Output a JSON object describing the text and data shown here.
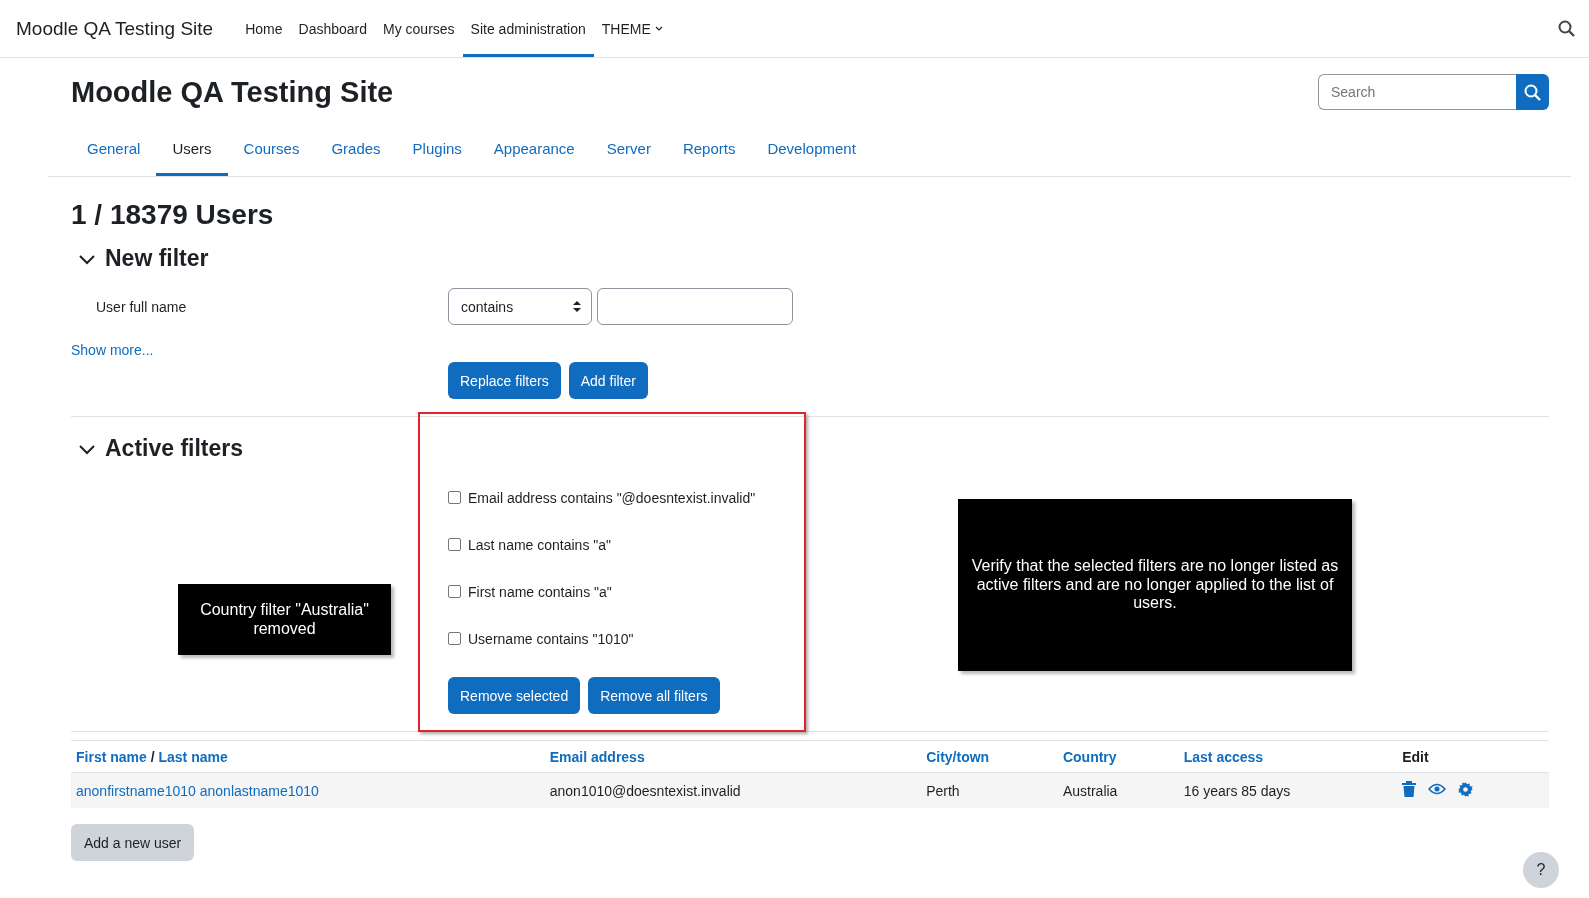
{
  "navbar": {
    "brand": "Moodle QA Testing Site",
    "items": [
      {
        "label": "Home",
        "selected": false,
        "kind": "link"
      },
      {
        "label": "Dashboard",
        "selected": false,
        "kind": "link"
      },
      {
        "label": "My courses",
        "selected": false,
        "kind": "link"
      },
      {
        "label": "Site administration",
        "selected": true,
        "kind": "link"
      },
      {
        "label": "THEME",
        "selected": false,
        "kind": "dropdown"
      }
    ]
  },
  "header": {
    "title": "Moodle QA Testing Site",
    "search": {
      "placeholder": "Search"
    }
  },
  "tabs": [
    {
      "label": "General",
      "selected": false
    },
    {
      "label": "Users",
      "selected": true
    },
    {
      "label": "Courses",
      "selected": false
    },
    {
      "label": "Grades",
      "selected": false
    },
    {
      "label": "Plugins",
      "selected": false
    },
    {
      "label": "Appearance",
      "selected": false
    },
    {
      "label": "Server",
      "selected": false
    },
    {
      "label": "Reports",
      "selected": false
    },
    {
      "label": "Development",
      "selected": false
    }
  ],
  "page_heading": "1 / 18379 Users",
  "new_filter": {
    "title": "New filter",
    "expanded": true,
    "field_label": "User full name",
    "operator": "contains",
    "show_more": "Show more...",
    "buttons": [
      "Replace filters",
      "Add filter"
    ]
  },
  "active_filters": {
    "title": "Active filters",
    "expanded": true,
    "filters": [
      {
        "label": "Email address contains \"@doesntexist.invalid\"",
        "checked": false
      },
      {
        "label": "Last name contains \"a\"",
        "checked": false
      },
      {
        "label": "First name contains \"a\"",
        "checked": false
      },
      {
        "label": "Username contains \"1010\"",
        "checked": false
      }
    ],
    "buttons": [
      "Remove selected",
      "Remove all filters"
    ]
  },
  "table": {
    "columns": [
      {
        "kind": "split",
        "label": "First name",
        "separator": "/",
        "label_2": "Last name"
      },
      {
        "kind": "link",
        "label": "Email address"
      },
      {
        "kind": "link",
        "label": "City/town"
      },
      {
        "kind": "link",
        "label": "Country"
      },
      {
        "kind": "link",
        "label": "Last access"
      },
      {
        "kind": "plain",
        "label": "Edit"
      }
    ],
    "rows": [
      {
        "name": "anonfirstname1010 anonlastname1010",
        "email": "anon1010@doesntexist.invalid",
        "city": "Perth",
        "country": "Australia",
        "last_access": "16 years 85 days"
      }
    ]
  },
  "add_user_button": "Add a new user",
  "callouts": [
    {
      "text": "Country filter \"Australia\" removed"
    },
    {
      "text": "Verify that the selected filters are no longer listed as active filters and are no longer applied to the list of users."
    }
  ],
  "help_button": "?"
}
